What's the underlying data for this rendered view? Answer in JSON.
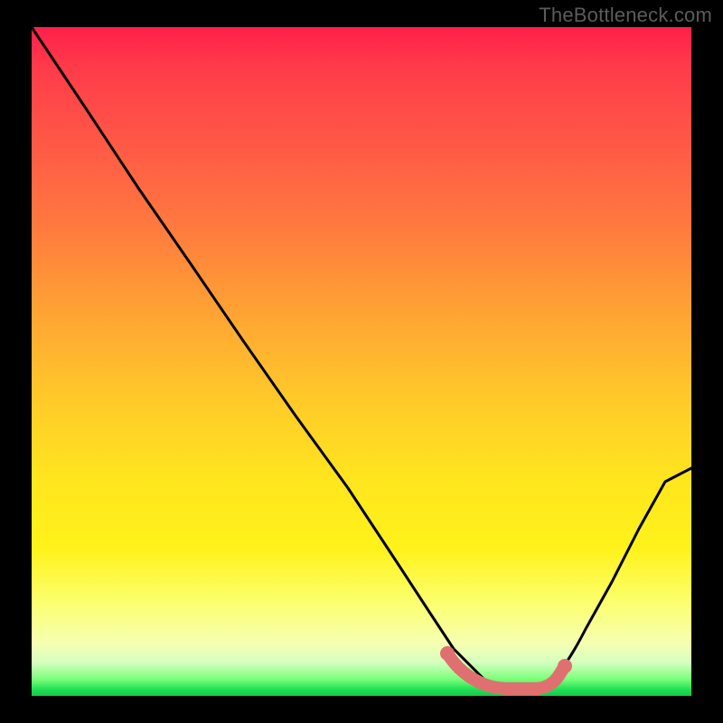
{
  "watermark": "TheBottleneck.com",
  "chart_data": {
    "type": "line",
    "title": "",
    "xlabel": "",
    "ylabel": "",
    "xlim": [
      0,
      100
    ],
    "ylim": [
      0,
      100
    ],
    "grid": false,
    "legend": false,
    "series": [
      {
        "name": "bottleneck-curve",
        "x": [
          0,
          8,
          16,
          24,
          32,
          40,
          48,
          56,
          60,
          64,
          68,
          72,
          76,
          80,
          84,
          88,
          92,
          96,
          100
        ],
        "values": [
          100,
          88,
          76,
          64.5,
          53,
          42,
          31,
          19,
          13,
          7,
          3,
          1,
          1,
          2,
          5,
          10,
          17,
          25,
          34
        ]
      }
    ],
    "markers": {
      "name": "optimal-range-highlight",
      "color": "#e06a6a",
      "x_start": 63,
      "x_end": 80,
      "y_approx": 1.5
    },
    "gradient_stops": [
      {
        "pos": 0,
        "color": "#ff1f4a"
      },
      {
        "pos": 30,
        "color": "#ff7a3e"
      },
      {
        "pos": 55,
        "color": "#ffc82a"
      },
      {
        "pos": 78,
        "color": "#fff21a"
      },
      {
        "pos": 92,
        "color": "#f6ffb0"
      },
      {
        "pos": 100,
        "color": "#14c94a"
      }
    ]
  }
}
